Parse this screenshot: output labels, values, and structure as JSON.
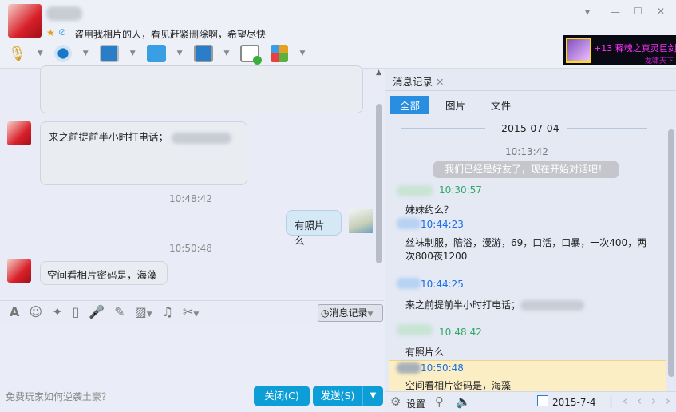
{
  "header": {
    "signature": "盗用我相片的人，看见赶紧删除啊，希望尽快",
    "ad_text": "+13 释魂之真灵巨剑",
    "ad_subtext": "龙啸天下"
  },
  "window_controls": {
    "menu": "▾",
    "minimize": "—",
    "maximize": "☐",
    "close": "✕"
  },
  "chat": {
    "messages": [
      {
        "side": "left",
        "text": "来之前提前半小时打电话；"
      },
      {
        "time": "10:48:42"
      },
      {
        "side": "right",
        "text": "有照片么"
      },
      {
        "time": "10:50:48"
      },
      {
        "side": "left",
        "text": "空间看相片密码是，海藻"
      }
    ]
  },
  "input_toolbar": {
    "history_button": "消息记录"
  },
  "footer": {
    "ad_link": "免费玩家如何逆袭土豪？",
    "close_button": "关闭(C)",
    "send_button": "发送(S)"
  },
  "history": {
    "tab_label": "消息记录",
    "filters": [
      "全部",
      "图片",
      "文件"
    ],
    "date_divider": "2015-07-04",
    "system_time": "10:13:42",
    "system_msg": "我们已经是好友了，现在开始对话吧！",
    "entries": [
      {
        "time": "10:30:57",
        "text": "妹妹约么？",
        "color": "#2fa866"
      },
      {
        "time": "10:44:23",
        "text": "丝袜制服，陪浴，漫游，69，口活，口暴，一次400，两次800夜1200",
        "color": "#1a6ee6"
      },
      {
        "time": "10:44:25",
        "text": "来之前提前半小时打电话；",
        "color": "#1a6ee6"
      },
      {
        "time": "10:48:42",
        "text": "有照片么",
        "color": "#2fa866"
      },
      {
        "time": "10:50:48",
        "text": "空间看相片密码是，海藻",
        "color": "#1a6ee6"
      }
    ],
    "settings_label": "设置",
    "date": "2015-7-4"
  }
}
